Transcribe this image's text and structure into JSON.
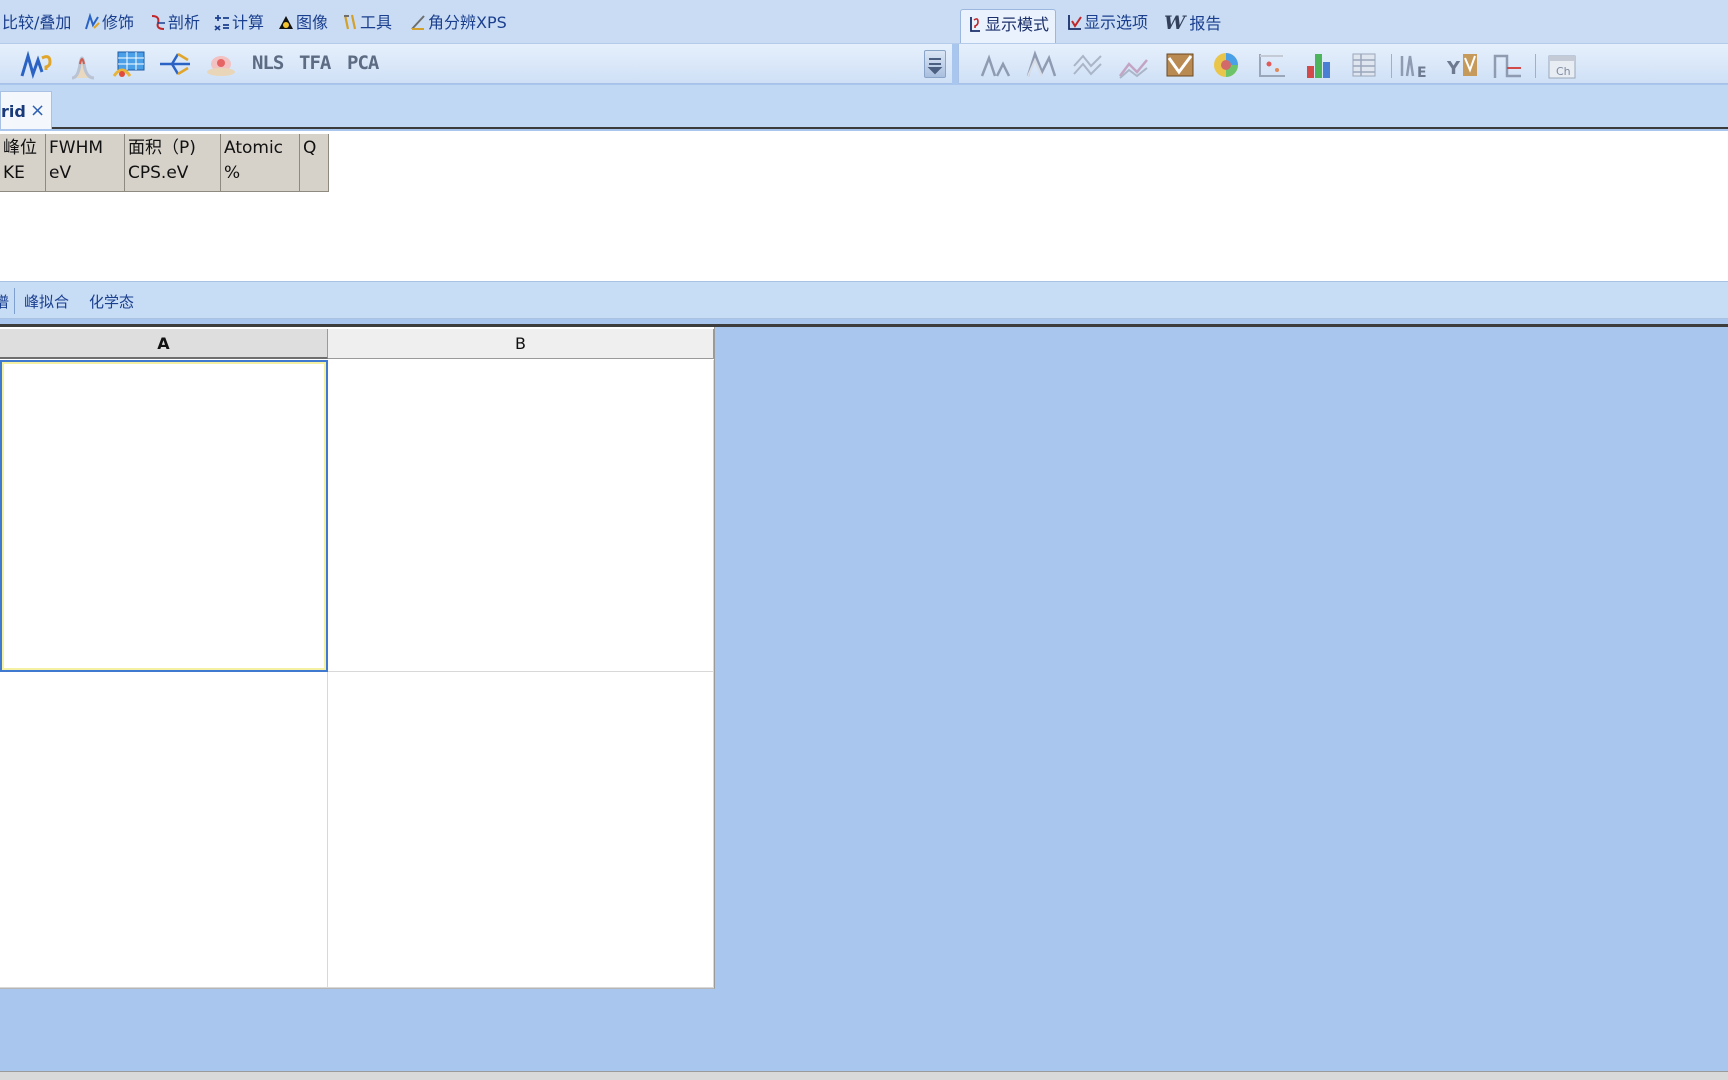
{
  "menu": {
    "items": [
      {
        "label": "比较/叠加",
        "icon": "compare-overlay-icon"
      },
      {
        "label": "修饰",
        "icon": "modify-icon"
      },
      {
        "label": "剖析",
        "icon": "profile-icon"
      },
      {
        "label": "计算",
        "icon": "calculate-icon"
      },
      {
        "label": "图像",
        "icon": "image-icon"
      },
      {
        "label": "工具",
        "icon": "tools-icon"
      },
      {
        "label": "角分辨XPS",
        "icon": "angle-resolved-xps-icon"
      }
    ],
    "right_items": [
      {
        "label": "显示模式",
        "icon": "display-mode-icon",
        "active": true
      },
      {
        "label": "显示选项",
        "icon": "display-options-icon"
      },
      {
        "label": "报告",
        "icon": "report-icon"
      }
    ]
  },
  "toolbar_left": {
    "icons": [
      "peak-fit-icon",
      "peak-shape-icon",
      "table-chart-icon",
      "split-icon",
      "blob-icon"
    ],
    "text_buttons": [
      "NLS",
      "TFA",
      "PCA"
    ]
  },
  "toolbar_right": {
    "icons": [
      "spectrum-line-icon",
      "spectrum-peaks-icon",
      "spectrum-stack-icon",
      "spectrum-overlay-icon",
      "chart-map-icon",
      "pie-chart-icon",
      "scatter-icon",
      "bar-chart-icon",
      "table-icon",
      "energy-icon",
      "y-axis-icon",
      "step-icon",
      "chart-window-icon"
    ]
  },
  "doc_tab": {
    "label": "rid",
    "close": "×"
  },
  "peak_table": {
    "headers": [
      {
        "line1": "峰位",
        "line2": "KE"
      },
      {
        "line1": "FWHM",
        "line2": "eV"
      },
      {
        "line1": "面积（P)",
        "line2": "CPS.eV"
      },
      {
        "line1": "Atomic",
        "line2": "%"
      },
      {
        "line1": "Q",
        "line2": ""
      }
    ]
  },
  "lower_tabs": {
    "cut_label": "谱",
    "items": [
      "峰拟合",
      "化学态"
    ]
  },
  "grid": {
    "columns": [
      "A",
      "B"
    ],
    "active_column": "A"
  },
  "colors": {
    "menu_bg": "#c9dcf3",
    "workspace_bg": "#a8c6ee",
    "accent_text": "#1b3f8f",
    "selection_border": "#3f7ad0"
  }
}
